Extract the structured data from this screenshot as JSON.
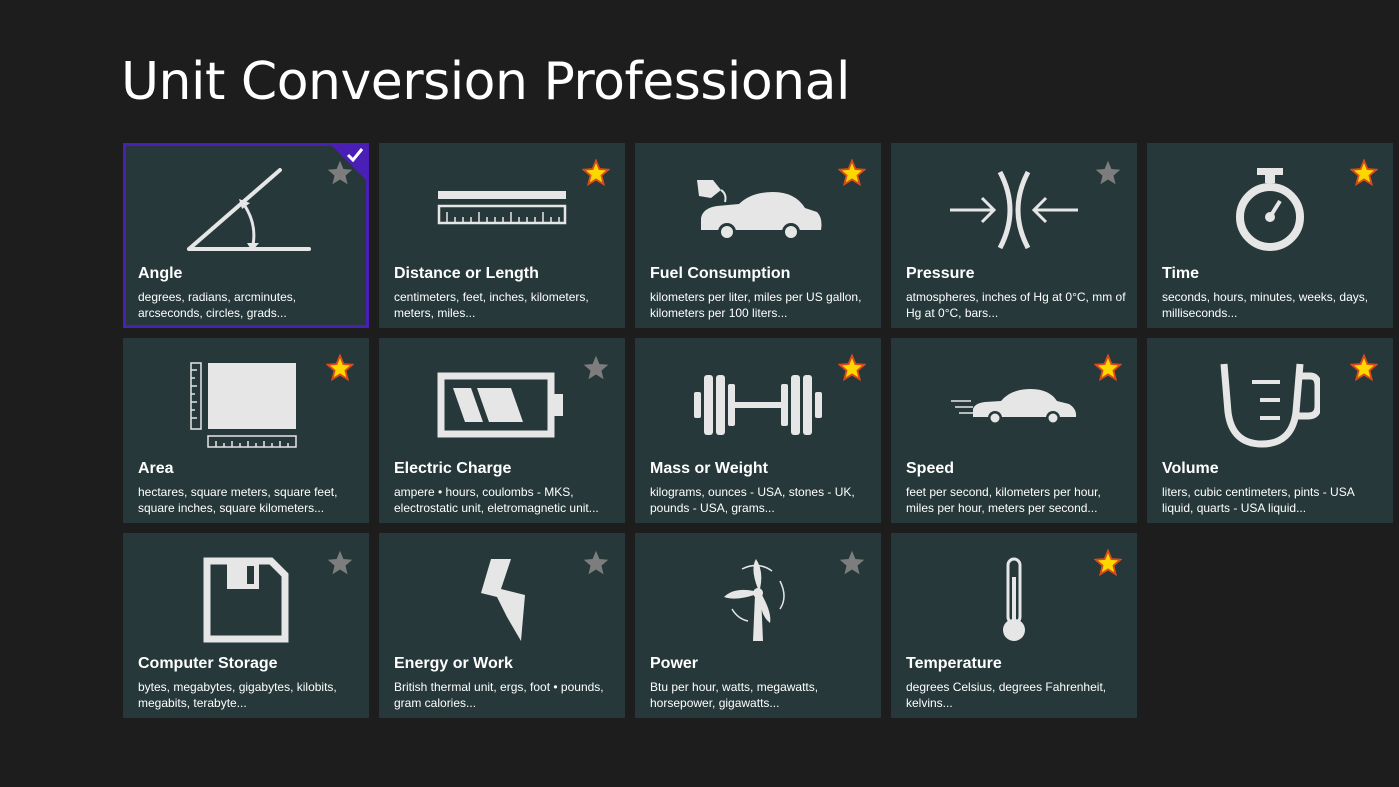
{
  "app": {
    "title": "Unit Conversion Professional"
  },
  "colors": {
    "tile_bg": "#263839",
    "selected_border": "#4a1fb5",
    "star_gold": "#ffd700",
    "star_gray": "#7d7d7d"
  },
  "tiles": [
    {
      "name": "Angle",
      "desc": "degrees, radians, arcminutes, arcseconds, circles, grads...",
      "icon": "angle-icon",
      "favorite": false,
      "selected": true
    },
    {
      "name": "Distance or Length",
      "desc": "centimeters, feet, inches, kilometers, meters, miles...",
      "icon": "ruler-icon",
      "favorite": true,
      "selected": false
    },
    {
      "name": "Fuel Consumption",
      "desc": "kilometers per liter, miles per US gallon, kilometers per 100 liters...",
      "icon": "car-fuel-icon",
      "favorite": true,
      "selected": false
    },
    {
      "name": "Pressure",
      "desc": "atmospheres, inches of Hg at 0°C, mm of Hg at 0°C, bars...",
      "icon": "pressure-icon",
      "favorite": false,
      "selected": false
    },
    {
      "name": "Time",
      "desc": "seconds, hours, minutes, weeks, days, milliseconds...",
      "icon": "stopwatch-icon",
      "favorite": true,
      "selected": false
    },
    {
      "name": "Area",
      "desc": "hectares, square meters, square feet, square inches, square kilometers...",
      "icon": "area-icon",
      "favorite": true,
      "selected": false
    },
    {
      "name": "Electric Charge",
      "desc": "ampere • hours, coulombs - MKS, electrostatic unit, eletromagnetic unit...",
      "icon": "battery-icon",
      "favorite": false,
      "selected": false
    },
    {
      "name": "Mass or Weight",
      "desc": "kilograms, ounces - USA, stones - UK, pounds - USA, grams...",
      "icon": "barbell-icon",
      "favorite": true,
      "selected": false
    },
    {
      "name": "Speed",
      "desc": "feet per second, kilometers per hour, miles per hour, meters per second...",
      "icon": "speeding-car-icon",
      "favorite": true,
      "selected": false
    },
    {
      "name": "Volume",
      "desc": "liters, cubic centimeters, pints - USA liquid, quarts - USA liquid...",
      "icon": "measuring-jug-icon",
      "favorite": true,
      "selected": false
    },
    {
      "name": "Computer Storage",
      "desc": "bytes, megabytes, gigabytes, kilobits, megabits, terabyte...",
      "icon": "floppy-disk-icon",
      "favorite": false,
      "selected": false
    },
    {
      "name": "Energy or Work",
      "desc": "British thermal unit, ergs, foot • pounds, gram calories...",
      "icon": "lightning-bolt-icon",
      "favorite": false,
      "selected": false
    },
    {
      "name": "Power",
      "desc": "Btu per hour, watts, megawatts, horsepower, gigawatts...",
      "icon": "wind-turbine-icon",
      "favorite": false,
      "selected": false
    },
    {
      "name": "Temperature",
      "desc": "degrees Celsius, degrees Fahrenheit, kelvins...",
      "icon": "thermometer-icon",
      "favorite": true,
      "selected": false
    }
  ]
}
